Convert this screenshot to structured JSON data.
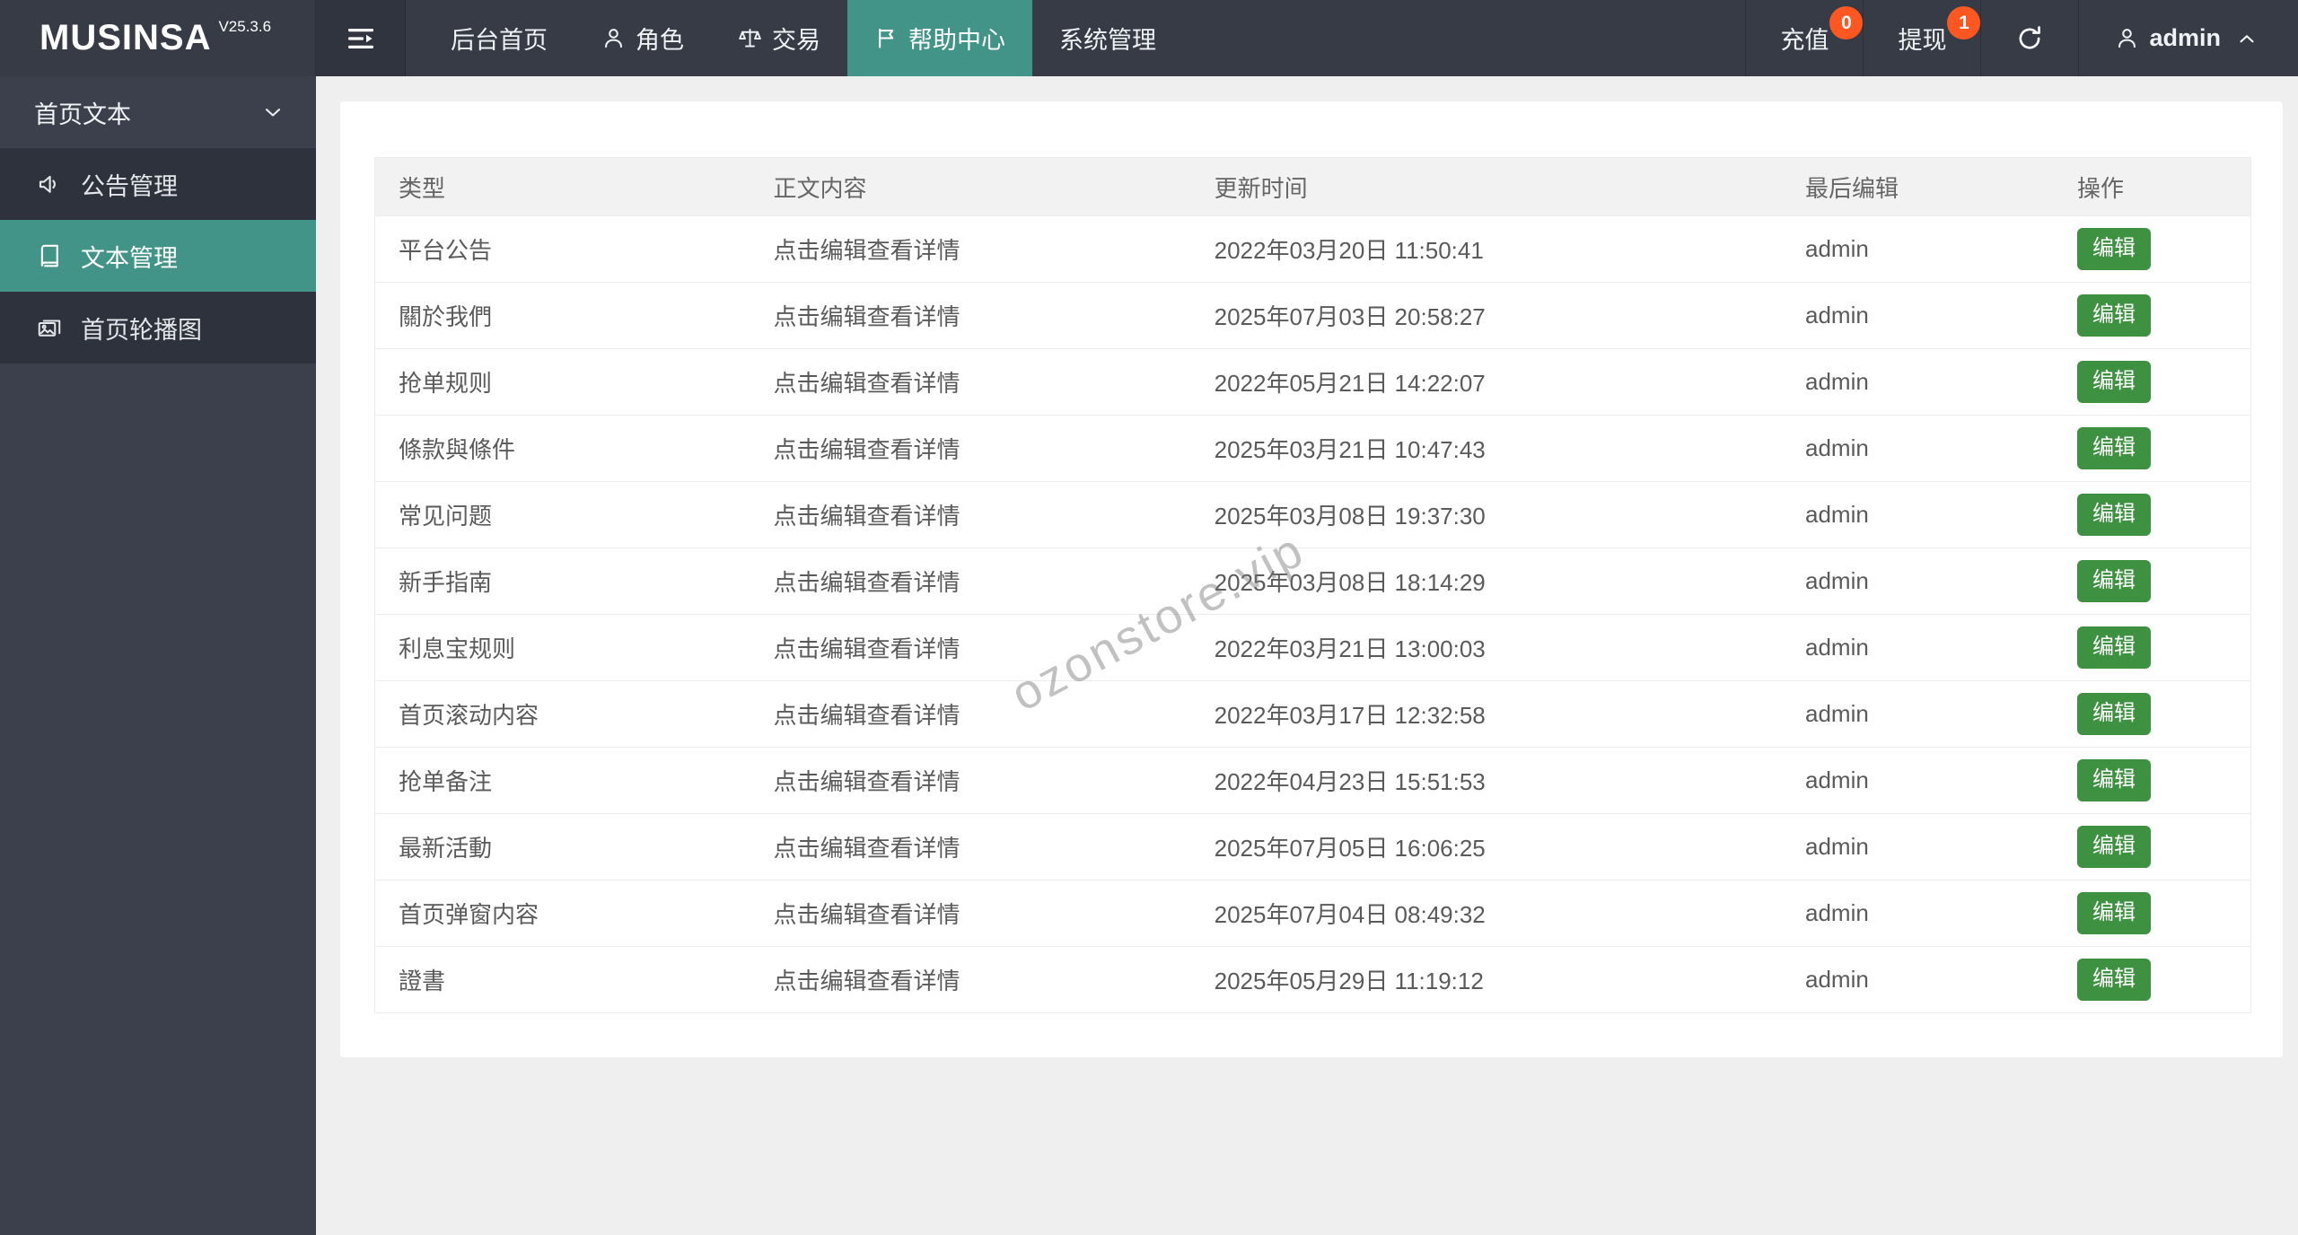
{
  "header": {
    "logo": "MUSINSA",
    "version": "V25.3.6",
    "nav": [
      {
        "label": "后台首页",
        "icon": null
      },
      {
        "label": "角色",
        "icon": "user-icon"
      },
      {
        "label": "交易",
        "icon": "scales-icon"
      },
      {
        "label": "帮助中心",
        "icon": "flag-icon",
        "active": true
      },
      {
        "label": "系统管理",
        "icon": null
      }
    ],
    "actions": {
      "recharge": {
        "label": "充值",
        "badge": "0"
      },
      "withdraw": {
        "label": "提现",
        "badge": "1"
      },
      "refresh": {
        "icon": "refresh-icon"
      },
      "user": {
        "label": "admin",
        "icon": "user-icon",
        "chevron": "chevron-up-icon"
      }
    }
  },
  "sidebar": {
    "group": {
      "label": "首页文本",
      "chevron": "chevron-down-icon"
    },
    "items": [
      {
        "label": "公告管理",
        "icon": "speaker-icon",
        "active": false
      },
      {
        "label": "文本管理",
        "icon": "book-icon",
        "active": true
      },
      {
        "label": "首页轮播图",
        "icon": "carousel-icon",
        "active": false
      }
    ]
  },
  "table": {
    "headers": [
      "类型",
      "正文内容",
      "更新时间",
      "最后编辑",
      "操作"
    ],
    "edit_label": "编辑",
    "rows": [
      {
        "type": "平台公告",
        "content": "点击编辑查看详情",
        "updated": "2022年03月20日 11:50:41",
        "editor": "admin"
      },
      {
        "type": "關於我們",
        "content": "点击编辑查看详情",
        "updated": "2025年07月03日 20:58:27",
        "editor": "admin"
      },
      {
        "type": "抢单规则",
        "content": "点击编辑查看详情",
        "updated": "2022年05月21日 14:22:07",
        "editor": "admin"
      },
      {
        "type": "條款與條件",
        "content": "点击编辑查看详情",
        "updated": "2025年03月21日 10:47:43",
        "editor": "admin"
      },
      {
        "type": "常见问题",
        "content": "点击编辑查看详情",
        "updated": "2025年03月08日 19:37:30",
        "editor": "admin"
      },
      {
        "type": "新手指南",
        "content": "点击编辑查看详情",
        "updated": "2025年03月08日 18:14:29",
        "editor": "admin"
      },
      {
        "type": "利息宝规则",
        "content": "点击编辑查看详情",
        "updated": "2022年03月21日 13:00:03",
        "editor": "admin"
      },
      {
        "type": "首页滚动内容",
        "content": "点击编辑查看详情",
        "updated": "2022年03月17日 12:32:58",
        "editor": "admin"
      },
      {
        "type": "抢单备注",
        "content": "点击编辑查看详情",
        "updated": "2022年04月23日 15:51:53",
        "editor": "admin"
      },
      {
        "type": "最新活動",
        "content": "点击编辑查看详情",
        "updated": "2025年07月05日 16:06:25",
        "editor": "admin"
      },
      {
        "type": "首页弹窗内容",
        "content": "点击编辑查看详情",
        "updated": "2025年07月04日 08:49:32",
        "editor": "admin"
      },
      {
        "type": "證書",
        "content": "点击编辑查看详情",
        "updated": "2025年05月29日 11:19:12",
        "editor": "admin"
      }
    ]
  },
  "watermark": {
    "text": "ozonstore.vip"
  },
  "colors": {
    "accent_teal": "#429488",
    "button_green": "#3e9140",
    "badge_orange": "#ff5722",
    "navbar_bg": "#363b46",
    "sidebar_bg": "#3b404c",
    "submenu_bg": "#2e323c",
    "content_bg": "#efefef",
    "table_header_bg": "#f2f2f2"
  }
}
